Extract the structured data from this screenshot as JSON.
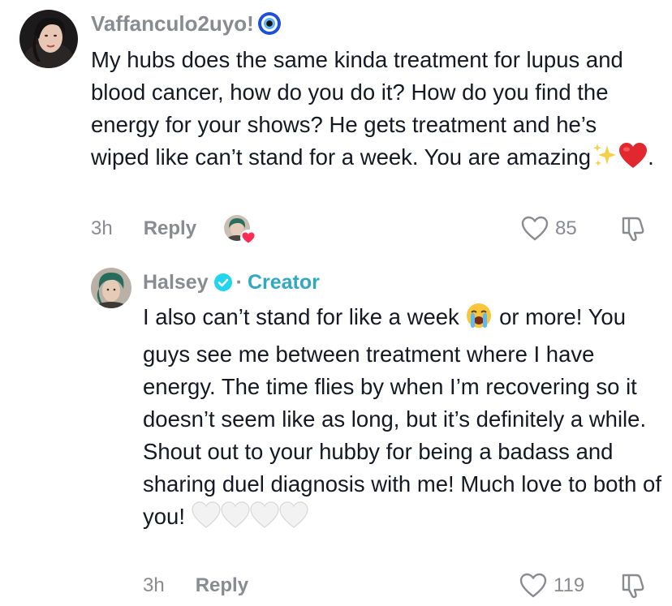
{
  "comments": [
    {
      "username": "Vaffanculo2uyo!",
      "username_emoji_icon": "evil-eye-icon",
      "text_before_emoji": "My hubs does the same kinda treatment for lupus and blood cancer, how do you do it? How do you find the energy for your shows? He gets treatment and he’s wiped like can’t stand for a week. You are amazing",
      "text_emojis": [
        "sparkles-icon",
        "red-heart-icon"
      ],
      "text_after_emoji": ".",
      "time": "3h",
      "reply_label": "Reply",
      "liked_by_creator": true,
      "like_count": "85"
    },
    {
      "username": "Halsey",
      "verified": true,
      "separator": "·",
      "creator_label": "Creator",
      "text_part1": "I also can’t stand for like a week",
      "text_part1_emoji": "loudly-crying-face-icon",
      "text_part2": "or more! You guys see me between treatment where I have energy. The time flies by when I’m recovering so it doesn’t seem like as long, but it’s definitely a while. Shout out to your hubby for being a badass and sharing duel diagnosis with me! Much love to both of you!",
      "text_end_emojis": [
        "white-heart-icon",
        "white-heart-icon",
        "white-heart-icon",
        "white-heart-icon"
      ],
      "time": "3h",
      "reply_label": "Reply",
      "like_count": "119"
    }
  ],
  "colors": {
    "text": "#161823",
    "muted": "#8a8b91",
    "creator": "#2fa8c4",
    "verified": "#20d5ec",
    "heart_red": "#fe2c55"
  }
}
